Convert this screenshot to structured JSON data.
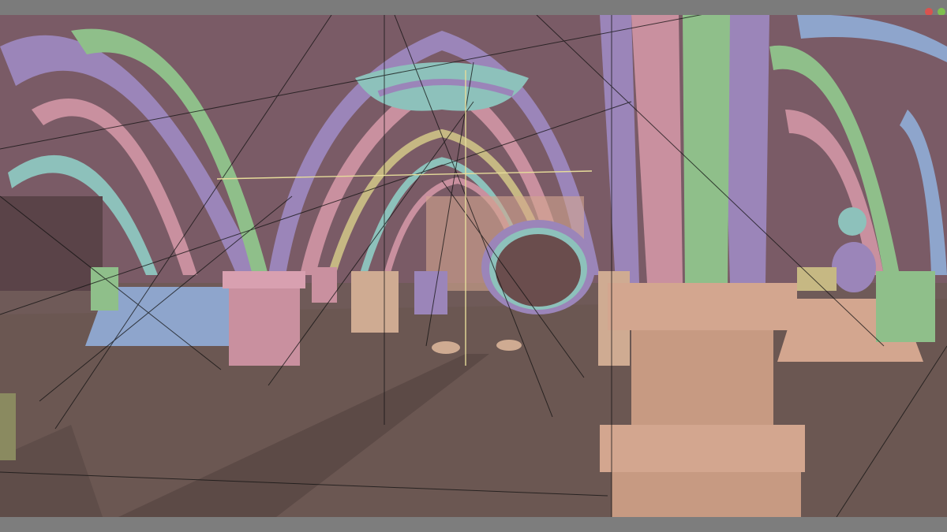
{
  "window": {
    "title": ""
  },
  "viewport": {
    "mode": "solid-random-color",
    "overlay": "wireframe-lines"
  },
  "gizmo": {
    "icons": [
      "navigation-gizmo-x-dot",
      "navigation-gizmo-y-dot",
      "navigation-gizmo-z-dot"
    ],
    "colors": {
      "x": "#d9534f",
      "y": "#7fbf4f",
      "z": "#4f7fd9"
    }
  },
  "palette": {
    "floor": "#6b5752",
    "wall": "#7a5b66",
    "purple": "#9b85b9",
    "pink": "#c9909f",
    "green": "#8fbf8a",
    "teal": "#8dc1bb",
    "blue": "#8ea5cc",
    "tan": "#cfab92",
    "light_tan": "#d3a68f",
    "yellow": "#c6b883",
    "ground_line": "#000000",
    "crosshair": "#e6dc9a"
  }
}
